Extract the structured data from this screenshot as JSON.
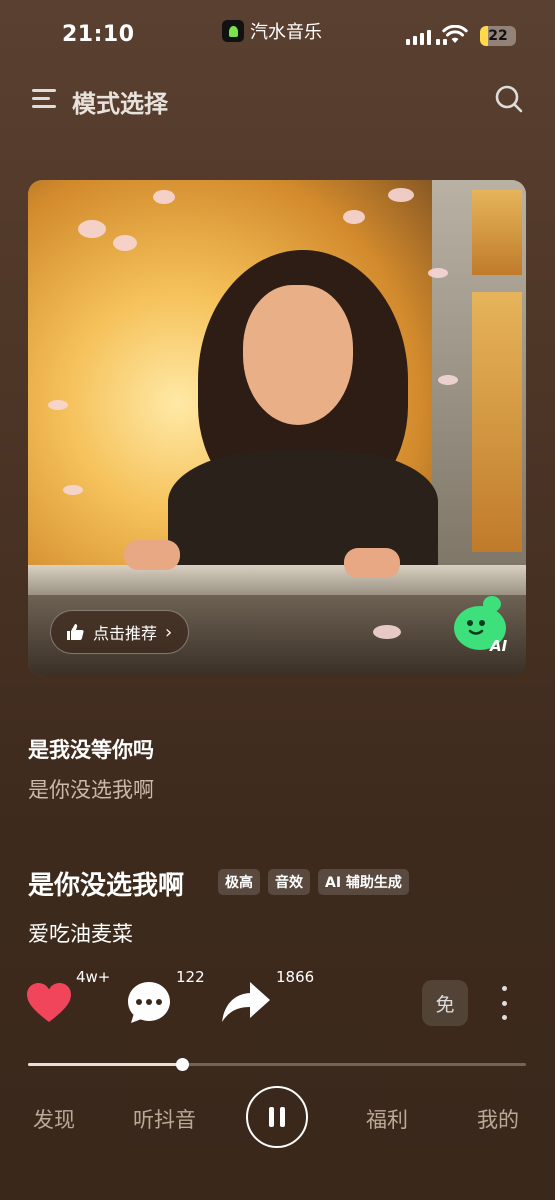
{
  "status_bar": {
    "time": "21:10",
    "app_name": "汽水音乐",
    "battery": "22",
    "battery_level": 0.22
  },
  "header": {
    "menu_icon": "menu-icon",
    "title": "模式选择",
    "search_icon": "search-icon"
  },
  "cover": {
    "recommend_label": "点击推荐",
    "ai_badge": "AI"
  },
  "lyrics": {
    "current": "是我没等你吗",
    "next": "是你没选我啊"
  },
  "song": {
    "title": "是你没选我啊",
    "tags": [
      "极高",
      "音效",
      "AI 辅助生成"
    ],
    "artist": "爱吃油麦菜"
  },
  "actions": {
    "like_count": "4w+",
    "comment_count": "122",
    "share_count": "1866",
    "free_label": "免",
    "like_color": "#f0455a"
  },
  "progress": {
    "fraction": 0.31
  },
  "nav": {
    "discover": "发现",
    "douyin": "听抖音",
    "welfare": "福利",
    "mine": "我的"
  }
}
